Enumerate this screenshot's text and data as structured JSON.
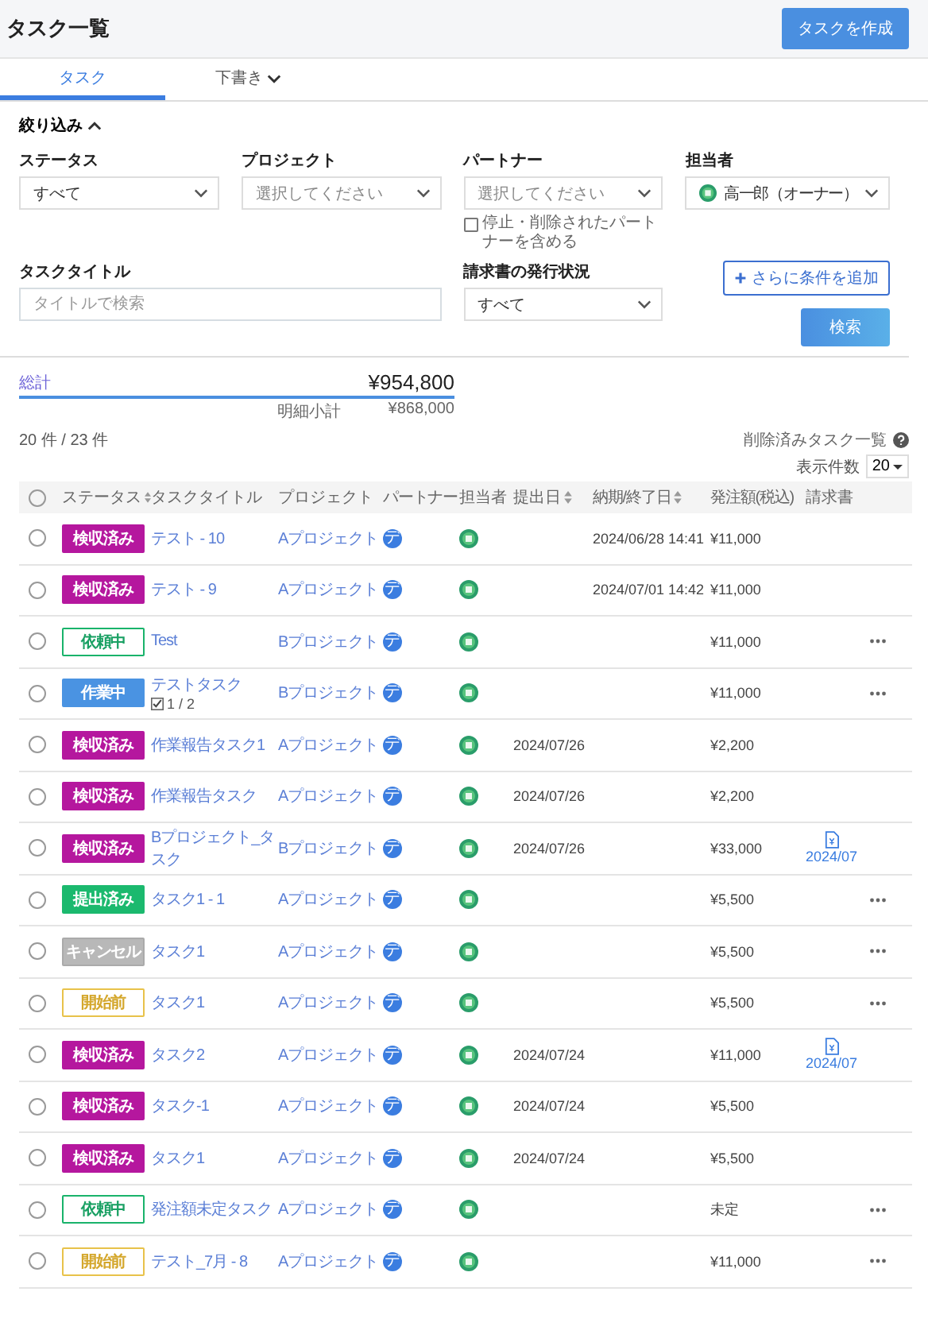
{
  "header": {
    "title": "タスク一覧",
    "create_button": "タスクを作成"
  },
  "tabs": [
    {
      "label": "タスク",
      "selected": true,
      "dropdown": false
    },
    {
      "label": "下書き",
      "selected": false,
      "dropdown": true
    }
  ],
  "filters": {
    "toggle": "絞り込み",
    "expanded": true,
    "status": {
      "label": "ステータス",
      "value": "すべて"
    },
    "project": {
      "label": "プロジェクト",
      "placeholder": "選択してください"
    },
    "partner": {
      "label": "パートナー",
      "placeholder": "選択してください",
      "include_label": "停止・削除されたパートナーを含める",
      "include_checked": false
    },
    "assignee": {
      "label": "担当者",
      "value": "高一郎（オーナー）"
    },
    "title": {
      "label": "タスクタイトル",
      "placeholder": "タイトルで検索"
    },
    "invoice_status": {
      "label": "請求書の発行状況",
      "value": "すべて"
    },
    "add_condition": "さらに条件を追加",
    "search": "検索"
  },
  "totals": {
    "label": "総計",
    "total": "¥954,800",
    "subtotal_label": "明細小計",
    "subtotal": "¥868,000"
  },
  "count": "20 件 / 23 件",
  "deleted_link": "削除済みタスク一覧",
  "page_size": {
    "label": "表示件数",
    "value": "20"
  },
  "table": {
    "select_all": false,
    "columns": [
      {
        "label": "ステータス",
        "sortable": true
      },
      {
        "label": "タスクタイトル",
        "sortable": false
      },
      {
        "label": "プロジェクト",
        "sortable": false
      },
      {
        "label": "パートナー",
        "sortable": false
      },
      {
        "label": "担当者",
        "sortable": false
      },
      {
        "label": "提出日",
        "sortable": true
      },
      {
        "label": "納期/終了日",
        "sortable": true
      },
      {
        "label": "発注額(税込)",
        "sortable": false
      },
      {
        "label": "請求書",
        "sortable": false
      }
    ],
    "rows": [
      {
        "selected": false,
        "status": {
          "label": "検収済み",
          "kind": "accepted"
        },
        "title": "テスト - 10",
        "project": "Aプロジェクト",
        "partner": "デ",
        "due": "2024/06/28 14:41",
        "amount": "¥11,000",
        "menu": false
      },
      {
        "selected": false,
        "status": {
          "label": "検収済み",
          "kind": "accepted"
        },
        "title": "テスト - 9",
        "project": "Aプロジェクト",
        "partner": "デ",
        "due": "2024/07/01 14:42",
        "amount": "¥11,000",
        "menu": false
      },
      {
        "selected": false,
        "status": {
          "label": "依頼中",
          "kind": "requested"
        },
        "title": "Test",
        "project": "Bプロジェクト",
        "partner": "デ",
        "amount": "¥11,000",
        "menu": true
      },
      {
        "selected": false,
        "status": {
          "label": "作業中",
          "kind": "working"
        },
        "title": "テストタスク",
        "subtasks": "1 / 2",
        "project": "Bプロジェクト",
        "partner": "デ",
        "amount": "¥11,000",
        "menu": true
      },
      {
        "selected": false,
        "status": {
          "label": "検収済み",
          "kind": "accepted"
        },
        "title": "作業報告タスク1",
        "project": "Aプロジェクト",
        "partner": "デ",
        "submitted": "2024/07/26",
        "amount": "¥2,200",
        "menu": false
      },
      {
        "selected": false,
        "status": {
          "label": "検収済み",
          "kind": "accepted"
        },
        "title": "作業報告タスク",
        "project": "Aプロジェクト",
        "partner": "デ",
        "submitted": "2024/07/26",
        "amount": "¥2,200",
        "menu": false
      },
      {
        "selected": false,
        "status": {
          "label": "検収済み",
          "kind": "accepted"
        },
        "title": "Bプロジェクト_タスク",
        "project": "Bプロジェクト",
        "partner": "デ",
        "submitted": "2024/07/26",
        "amount": "¥33,000",
        "invoice": "2024/07",
        "menu": false
      },
      {
        "selected": false,
        "status": {
          "label": "提出済み",
          "kind": "submitted"
        },
        "title": "タスク1 - 1",
        "project": "Aプロジェクト",
        "partner": "デ",
        "amount": "¥5,500",
        "menu": true
      },
      {
        "selected": false,
        "status": {
          "label": "キャンセル",
          "kind": "cancelled"
        },
        "title": "タスク1",
        "project": "Aプロジェクト",
        "partner": "デ",
        "amount": "¥5,500",
        "menu": true
      },
      {
        "selected": false,
        "status": {
          "label": "開始前",
          "kind": "pending"
        },
        "title": "タスク1",
        "project": "Aプロジェクト",
        "partner": "デ",
        "amount": "¥5,500",
        "menu": true
      },
      {
        "selected": false,
        "status": {
          "label": "検収済み",
          "kind": "accepted"
        },
        "title": "タスク2",
        "project": "Aプロジェクト",
        "partner": "デ",
        "submitted": "2024/07/24",
        "amount": "¥11,000",
        "invoice": "2024/07",
        "menu": false
      },
      {
        "selected": false,
        "status": {
          "label": "検収済み",
          "kind": "accepted"
        },
        "title": "タスク-1",
        "project": "Aプロジェクト",
        "partner": "デ",
        "submitted": "2024/07/24",
        "amount": "¥5,500",
        "menu": false
      },
      {
        "selected": false,
        "status": {
          "label": "検収済み",
          "kind": "accepted"
        },
        "title": "タスク1",
        "project": "Aプロジェクト",
        "partner": "デ",
        "submitted": "2024/07/24",
        "amount": "¥5,500",
        "menu": false
      },
      {
        "selected": false,
        "status": {
          "label": "依頼中",
          "kind": "requested"
        },
        "title": "発注額未定タスク",
        "project": "Aプロジェクト",
        "partner": "デ",
        "amount": "未定",
        "menu": true
      },
      {
        "selected": false,
        "status": {
          "label": "開始前",
          "kind": "pending"
        },
        "title": "テスト_7月 - 8",
        "project": "Aプロジェクト",
        "partner": "デ",
        "amount": "¥11,000",
        "menu": true
      }
    ]
  }
}
